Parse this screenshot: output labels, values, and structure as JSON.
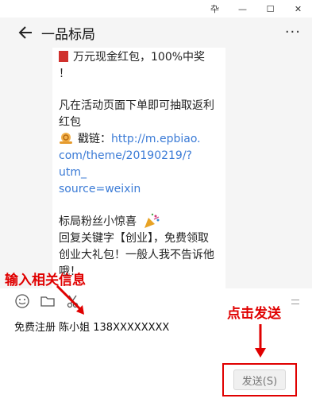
{
  "window": {
    "controls": [
      "卆",
      "—",
      "☐",
      "✕"
    ]
  },
  "header": {
    "title": "一品标局",
    "more": "···"
  },
  "message": {
    "line1": "万元现金红包，100%中奖",
    "line2": "！",
    "line3": "凡在活动页面下单即可抽取返利",
    "line4": "红包",
    "link_label": "戳链：",
    "link_1": "http://m.epbiao.",
    "link_2": "com/theme/20190219/?utm_",
    "link_3": "source=weixin",
    "line5": "标局粉丝小惊喜",
    "line6": "回复关键字【创业】，免费领取",
    "line7": "创业大礼包！一般人我不告诉他",
    "line8": "哦！"
  },
  "annotations": {
    "input_hint": "输入相关信息",
    "send_hint": "点击发送"
  },
  "input": {
    "value": "免费注册 陈小姐 138XXXXXXXX"
  },
  "send": {
    "label": "发送(S)"
  },
  "colors": {
    "accent": "#e00000",
    "link": "#3b7bd6"
  }
}
